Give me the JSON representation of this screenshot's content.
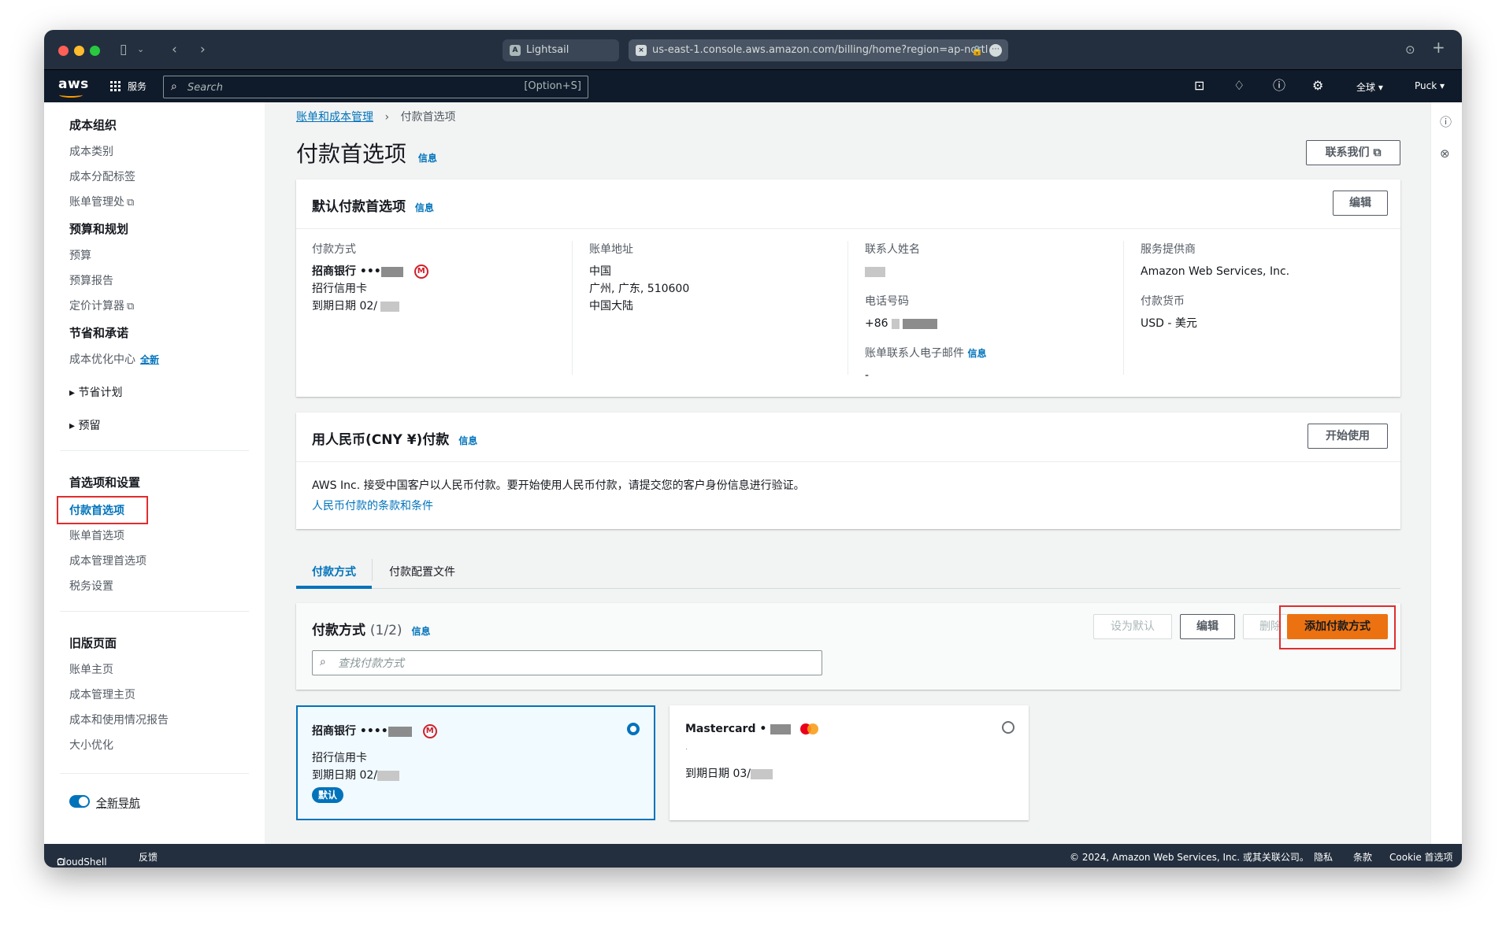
{
  "browser": {
    "tab1_title": "Lightsail",
    "tab1_favicon": "A",
    "url": "us-east-1.console.aws.amazon.com/billing/home?region=ap-nortl",
    "lock": "🔒"
  },
  "topnav": {
    "logo": "aws",
    "services": "服务",
    "search_placeholder": "Search",
    "search_shortcut": "[Option+S]",
    "region": "全球 ▾",
    "user": "Puck ▾"
  },
  "sidebar": {
    "section1": "成本组织",
    "cost_categories": "成本类别",
    "cost_allocation_tags": "成本分配标签",
    "billing_conductor": "账单管理处",
    "section2": "预算和规划",
    "budgets": "预算",
    "budget_reports": "预算报告",
    "pricing_calculator": "定价计算器",
    "section3": "节省和承诺",
    "cost_optimization_hub": "成本优化中心",
    "new_badge": "全新",
    "savings_plans": "节省计划",
    "reservations": "预留",
    "section4": "首选项和设置",
    "payment_preferences": "付款首选项",
    "billing_preferences": "账单首选项",
    "cost_management_preferences": "成本管理首选项",
    "tax_settings": "税务设置",
    "section5": "旧版页面",
    "bills_home": "账单主页",
    "cost_management_home": "成本管理主页",
    "cost_usage_reports": "成本和使用情况报告",
    "rightsizing": "大小优化",
    "new_nav_toggle": "全新导航"
  },
  "breadcrumb": {
    "parent": "账单和成本管理",
    "current": "付款首选项"
  },
  "page": {
    "title": "付款首选项",
    "info": "信息",
    "contact_us": "联系我们"
  },
  "default_prefs": {
    "title": "默认付款首选项",
    "edit": "编辑",
    "payment_method_label": "付款方式",
    "bank_name": "招商银行 •••",
    "card_type": "招行信用卡",
    "expiry": "到期日期 02/",
    "address_label": "账单地址",
    "address_line1": "中国",
    "address_line2": "广州, 广东, 510600",
    "address_line3": "中国大陆",
    "contact_name_label": "联系人姓名",
    "phone_label": "电话号码",
    "phone_prefix": "+86",
    "billing_email_label": "账单联系人电子邮件",
    "billing_email_value": "-",
    "provider_label": "服务提供商",
    "provider_value": "Amazon Web Services, Inc.",
    "currency_label": "付款货币",
    "currency_value": "USD - 美元"
  },
  "cny_panel": {
    "title": "用人民币(CNY ¥)付款",
    "get_started": "开始使用",
    "description": "AWS Inc. 接受中国客户以人民币付款。要开始使用人民币付款，请提交您的客户身份信息进行验证。",
    "terms_link": "人民币付款的条款和条件"
  },
  "tabs": {
    "payment_methods": "付款方式",
    "payment_profiles": "付款配置文件"
  },
  "methods_panel": {
    "title": "付款方式",
    "count": "(1/2)",
    "set_default": "设为默认",
    "edit": "编辑",
    "delete": "删除",
    "add": "添加付款方式",
    "search_placeholder": "查找付款方式"
  },
  "cards": [
    {
      "name": "招商银行 ••••",
      "type": "招行信用卡",
      "expiry": "到期日期 02/",
      "badge": "默认"
    },
    {
      "name": "Mastercard •",
      "type": ".",
      "expiry": "到期日期 03/"
    }
  ],
  "footer": {
    "cloudshell": "CloudShell",
    "feedback": "反馈",
    "copyright": "© 2024, Amazon Web Services, Inc. 或其关联公司。",
    "privacy": "隐私",
    "terms": "条款",
    "cookie": "Cookie 首选项"
  },
  "colors": {
    "accent": "#0073bb",
    "primary_button": "#ec7211",
    "highlight_box": "#e02d2d",
    "nav_bg": "#0f1b2a"
  }
}
